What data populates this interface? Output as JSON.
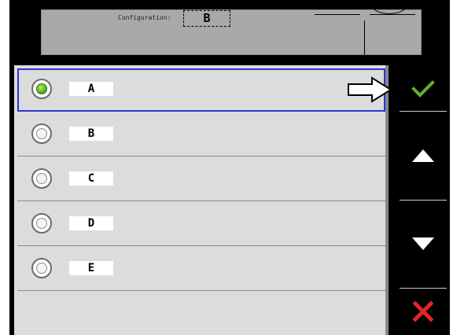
{
  "preview": {
    "configuration_label": "Configuration:",
    "configuration_value": "B"
  },
  "options": [
    {
      "label": "A",
      "selected": true
    },
    {
      "label": "B",
      "selected": false
    },
    {
      "label": "C",
      "selected": false
    },
    {
      "label": "D",
      "selected": false
    },
    {
      "label": "E",
      "selected": false
    }
  ],
  "controls": {
    "confirm_icon": "check-icon",
    "up_icon": "triangle-up-icon",
    "down_icon": "triangle-down-icon",
    "cancel_icon": "x-icon",
    "confirm_color": "#5fb32b",
    "cancel_color": "#e1252a",
    "selection_outline_color": "#2e34d6"
  }
}
